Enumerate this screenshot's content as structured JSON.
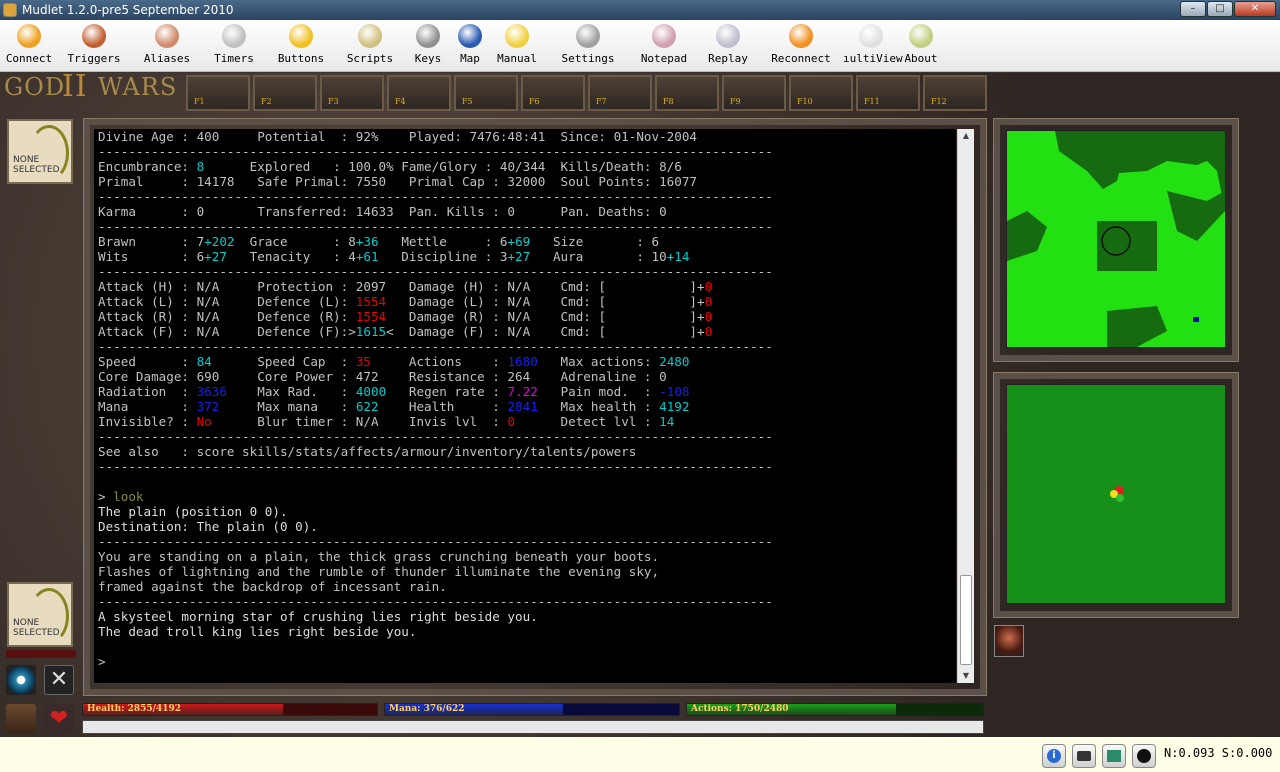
{
  "window": {
    "title": "Mudlet 1.2.0-pre5 September 2010"
  },
  "toolbar": {
    "items": [
      {
        "label": "Connect",
        "icon": "connect-icon"
      },
      {
        "label": "Triggers",
        "icon": "triggers-icon"
      },
      {
        "label": "Aliases",
        "icon": "aliases-icon"
      },
      {
        "label": "Timers",
        "icon": "timers-icon"
      },
      {
        "label": "Buttons",
        "icon": "buttons-icon"
      },
      {
        "label": "Scripts",
        "icon": "scripts-icon"
      },
      {
        "label": "Keys",
        "icon": "keys-icon"
      },
      {
        "label": "Map",
        "icon": "map-icon"
      },
      {
        "label": "Manual",
        "icon": "manual-icon"
      },
      {
        "label": "Settings",
        "icon": "settings-icon"
      },
      {
        "label": "Notepad",
        "icon": "notepad-icon"
      },
      {
        "label": "Replay",
        "icon": "replay-icon"
      },
      {
        "label": "Reconnect",
        "icon": "reconnect-icon"
      },
      {
        "label": "ıultiView",
        "icon": "multiview-icon"
      },
      {
        "label": "About",
        "icon": "about-icon"
      }
    ]
  },
  "logo": {
    "left": "GOD",
    "mid": "II",
    "right": "WARS"
  },
  "fkeys": [
    "F1",
    "F2",
    "F3",
    "F4",
    "F5",
    "F6",
    "F7",
    "F8",
    "F9",
    "F10",
    "F11",
    "F12"
  ],
  "avatars": {
    "top": {
      "line1": "NONE",
      "line2": "SELECTED"
    },
    "bottom": {
      "line1": "NONE",
      "line2": "SELECTED"
    }
  },
  "console": {
    "lines": [
      [
        [
          "Divine Age : 400     Potential  : 92%    Played: 7476:48:41  Since: 01-Nov-2004",
          ""
        ]
      ],
      [
        [
          "-----------------------------------------------------------------------------------------",
          ""
        ]
      ],
      [
        [
          "Encumbrance: ",
          ""
        ],
        [
          "8",
          "cy"
        ],
        [
          "      Explored   : 100.0% Fame/Glory : 40/344  Kills/Death: 8/6",
          ""
        ]
      ],
      [
        [
          "Primal     : 14178   Safe Primal: 7550   Primal Cap : 32000  Soul Points: 16077",
          ""
        ]
      ],
      [
        [
          "-----------------------------------------------------------------------------------------",
          ""
        ]
      ],
      [
        [
          "Karma      : 0       Transferred: 14633  Pan. Kills : 0      Pan. Deaths: 0",
          ""
        ]
      ],
      [
        [
          "-----------------------------------------------------------------------------------------",
          ""
        ]
      ],
      [
        [
          "Brawn      : 7",
          ""
        ],
        [
          "+202",
          "cy"
        ],
        [
          "  Grace      : 8",
          ""
        ],
        [
          "+36",
          "cy"
        ],
        [
          "   Mettle     : 6",
          ""
        ],
        [
          "+69",
          "cy"
        ],
        [
          "   Size       : 6",
          ""
        ]
      ],
      [
        [
          "Wits       : 6",
          ""
        ],
        [
          "+27",
          "cy"
        ],
        [
          "   Tenacity   : 4",
          ""
        ],
        [
          "+61",
          "cy"
        ],
        [
          "   Discipline : 3",
          ""
        ],
        [
          "+27",
          "cy"
        ],
        [
          "   Aura       : 10",
          ""
        ],
        [
          "+14",
          "cy"
        ]
      ],
      [
        [
          "-----------------------------------------------------------------------------------------",
          ""
        ]
      ],
      [
        [
          "Attack (H) : N/A     Protection : 2097   Damage (H) : N/A    Cmd: [           ]+",
          ""
        ],
        [
          "0",
          "rd"
        ]
      ],
      [
        [
          "Attack (L) : N/A     Defence (L): ",
          ""
        ],
        [
          "1554",
          "rd"
        ],
        [
          "   Damage (L) : N/A    Cmd: [           ]+",
          ""
        ],
        [
          "0",
          "rd"
        ]
      ],
      [
        [
          "Attack (R) : N/A     Defence (R): ",
          ""
        ],
        [
          "1554",
          "rd"
        ],
        [
          "   Damage (R) : N/A    Cmd: [           ]+",
          ""
        ],
        [
          "0",
          "rd"
        ]
      ],
      [
        [
          "Attack (F) : N/A     Defence (F):>",
          ""
        ],
        [
          "1615",
          "cy"
        ],
        [
          "<  Damage (F) : N/A    Cmd: [           ]+",
          ""
        ],
        [
          "0",
          "rd"
        ]
      ],
      [
        [
          "-----------------------------------------------------------------------------------------",
          ""
        ]
      ],
      [
        [
          "Speed      : ",
          ""
        ],
        [
          "84",
          "cy"
        ],
        [
          "      Speed Cap  : ",
          ""
        ],
        [
          "35",
          "rd"
        ],
        [
          "     Actions    : ",
          ""
        ],
        [
          "1680",
          "bl"
        ],
        [
          "   Max actions: ",
          ""
        ],
        [
          "2480",
          "cy"
        ]
      ],
      [
        [
          "Core Damage: 690     Core Power : 472    Resistance : 264    Adrenaline : 0",
          ""
        ]
      ],
      [
        [
          "Radiation  : ",
          ""
        ],
        [
          "3636",
          "bl"
        ],
        [
          "    Max Rad.   : ",
          ""
        ],
        [
          "4000",
          "cy"
        ],
        [
          "   Regen rate : ",
          ""
        ],
        [
          "7.22",
          "mg"
        ],
        [
          "   Pain mod.  : ",
          ""
        ],
        [
          "-108",
          "bl"
        ]
      ],
      [
        [
          "Mana       : ",
          ""
        ],
        [
          "372",
          "bl"
        ],
        [
          "     Max mana   : ",
          ""
        ],
        [
          "622",
          "cy"
        ],
        [
          "    Health     : ",
          ""
        ],
        [
          "2841",
          "bl"
        ],
        [
          "   Max health : ",
          ""
        ],
        [
          "4192",
          "cy"
        ]
      ],
      [
        [
          "Invisible? : ",
          ""
        ],
        [
          "No",
          "rd"
        ],
        [
          "      Blur timer : N/A    Invis lvl  : ",
          ""
        ],
        [
          "0",
          "rd"
        ],
        [
          "      Detect lvl : ",
          ""
        ],
        [
          "14",
          "cy"
        ]
      ],
      [
        [
          "-----------------------------------------------------------------------------------------",
          ""
        ]
      ],
      [
        [
          "See also   : score skills/stats/affects/armour/inventory/talents/powers",
          ""
        ]
      ],
      [
        [
          "-----------------------------------------------------------------------------------------",
          ""
        ]
      ],
      [
        [
          "",
          ""
        ]
      ],
      [
        [
          "> ",
          ""
        ],
        [
          "look",
          "ol"
        ]
      ],
      [
        [
          "The plain (position 0 0).",
          "wh"
        ]
      ],
      [
        [
          "Destination: The plain (0 0).",
          "wh"
        ]
      ],
      [
        [
          "-----------------------------------------------------------------------------------------",
          ""
        ]
      ],
      [
        [
          "You are standing on a plain, the thick grass crunching beneath your boots.",
          ""
        ]
      ],
      [
        [
          "Flashes of lightning and the rumble of thunder illuminate the evening sky,",
          ""
        ]
      ],
      [
        [
          "framed against the backdrop of incessant rain.",
          ""
        ]
      ],
      [
        [
          "-----------------------------------------------------------------------------------------",
          ""
        ]
      ],
      [
        [
          "A skysteel morning star of crushing lies right beside you.",
          "wh"
        ]
      ],
      [
        [
          "The dead troll king lies right beside you.",
          "wh"
        ]
      ],
      [
        [
          "",
          ""
        ]
      ],
      [
        [
          ">",
          ""
        ]
      ]
    ]
  },
  "bars": {
    "health": {
      "text": "Health: 2855/4192",
      "value": 0.681,
      "color": "#d01818"
    },
    "mana": {
      "text": "Mana: 376/622",
      "value": 0.604,
      "color": "#1830d0"
    },
    "actions": {
      "text": "Actions: 1750/2480",
      "value": 0.706,
      "color": "#18a018"
    }
  },
  "status": {
    "net": "N:0.093 S:0.000"
  }
}
